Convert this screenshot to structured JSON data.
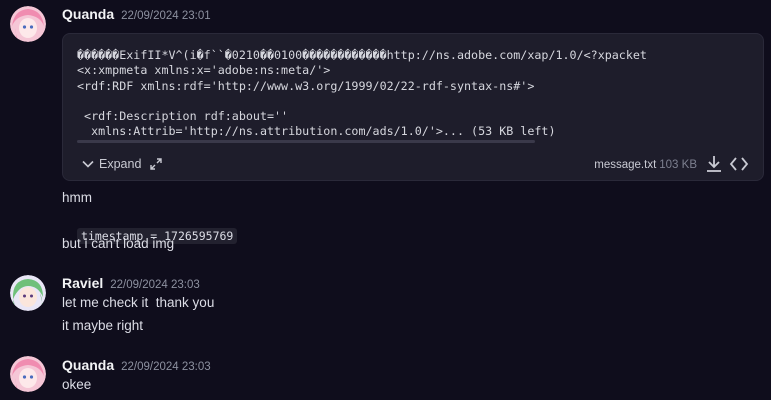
{
  "messages": [
    {
      "author": "Quanda",
      "time": "22/09/2024 23:01",
      "attachment": {
        "preview": "������ExifII*V^(i�f``�0210��0100������������http://ns.adobe.com/xap/1.0/<?xpacket\n<x:xmpmeta xmlns:x='adobe:ns:meta/'>\n<rdf:RDF xmlns:rdf='http://www.w3.org/1999/02/22-rdf-syntax-ns#'>\n\n <rdf:Description rdf:about=''\n  xmlns:Attrib='http://ns.attribution.com/ads/1.0/'>... (53 KB left)",
        "expand_label": "Expand",
        "filename": "message.txt",
        "filesize": "103 KB"
      },
      "lines": [
        "hmm",
        "but i can't load img"
      ],
      "code_prefix": "timestamp = 1726595769"
    },
    {
      "author": "Raviel",
      "time": "22/09/2024 23:03",
      "lines": [
        "let me check it  thank you",
        "it maybe right"
      ]
    },
    {
      "author": "Quanda",
      "time": "22/09/2024 23:03",
      "lines": [
        "okee"
      ]
    }
  ],
  "icons": {
    "chevron": "chevron-down-icon",
    "expand": "expand-arrows-icon",
    "download": "download-icon",
    "code": "code-brackets-icon"
  }
}
